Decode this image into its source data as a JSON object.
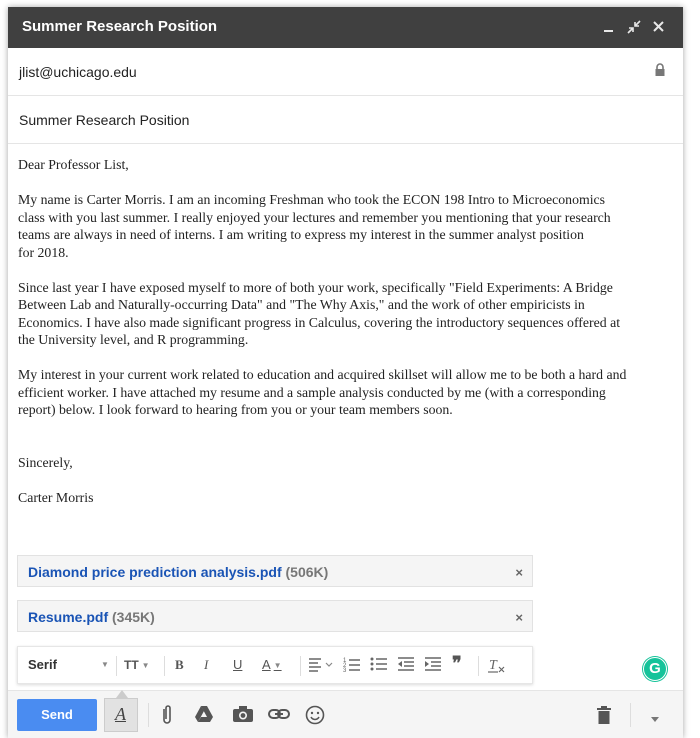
{
  "window": {
    "title": "Summer Research Position"
  },
  "recipients": {
    "to": "jlist@uchicago.edu"
  },
  "subject": "Summer Research Position",
  "body": {
    "greeting": "Dear Professor List,",
    "p1": "My name is Carter Morris. I am an incoming Freshman who took the ECON 198 Intro to Microeconomics\nclass with you last summer. I really enjoyed your lectures and remember you mentioning that your research\nteams are always in need of interns. I am writing to express my interest in the summer analyst position\nfor 2018.",
    "p2": "Since last year I have exposed myself to more of both your work, specifically \"Field Experiments: A Bridge\nBetween Lab and Naturally-occurring Data\" and \"The Why Axis,\" and the work of other empiricists in\nEconomics. I have also made significant progress in Calculus, covering the introductory sequences offered at\nthe University level, and R programming.",
    "p3": "My interest in your current work related to education and acquired skillset will allow me to be both a hard and\nefficient worker. I have attached my resume and a sample analysis conducted by me (with a corresponding\nreport) below. I look forward to hearing from you or your team members soon.",
    "closing": "Sincerely,",
    "signature": "Carter Morris"
  },
  "attachments": [
    {
      "name": "Diamond price prediction analysis.pdf",
      "size": "(506K)",
      "remove": "×"
    },
    {
      "name": "Resume.pdf",
      "size": "(345K)",
      "remove": "×"
    }
  ],
  "format_bar": {
    "font": "Serif",
    "size_icon": "TT",
    "bold": "B",
    "italic": "I",
    "underline": "U",
    "text_color": "A",
    "quote": "❞"
  },
  "grammarly_badge": "G",
  "bottom_bar": {
    "send_label": "Send",
    "format_toggle": "A"
  },
  "colors": {
    "titlebar": "#404040",
    "send": "#4a8cf1",
    "attachment_link": "#1a54b5",
    "grammarly": "#15c39a"
  }
}
